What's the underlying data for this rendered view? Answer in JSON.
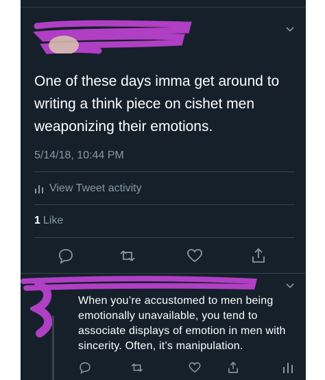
{
  "main_tweet": {
    "text": "One of these days imma get around to writing a think piece on cishet men weaponizing their emotions.",
    "timestamp": "5/14/18, 10:44 PM",
    "activity_label": "View Tweet activity",
    "like_count": "1",
    "like_label": "Like"
  },
  "reply_tweet": {
    "text": "When you’re accustomed to men being emotionally unavailable, you tend to associate displays of emotion in men with sincerity. Often, it’s manipulation."
  },
  "icons": {
    "reply": "reply-icon",
    "retweet": "retweet-icon",
    "like": "heart-icon",
    "share": "share-icon",
    "activity": "bar-chart-icon",
    "menu": "chevron-down-icon"
  },
  "colors": {
    "background": "#15202b",
    "text": "#ffffff",
    "muted": "#8899a6",
    "separator": "#38444d",
    "redaction": "#b03fc4"
  }
}
